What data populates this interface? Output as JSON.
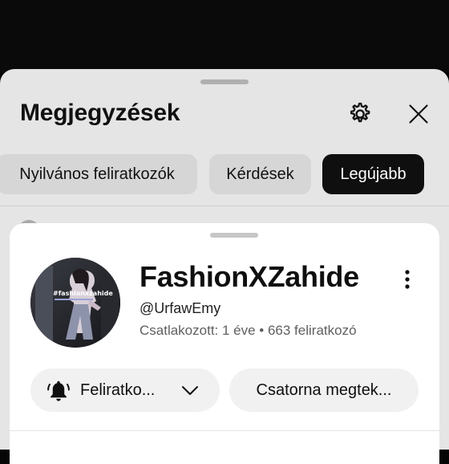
{
  "comments_panel": {
    "title": "Megjegyzések",
    "chips": [
      {
        "label": "Nyilvános feliratkozók",
        "selected": false
      },
      {
        "label": "Kérdések",
        "selected": false
      },
      {
        "label": "Legújabb",
        "selected": true
      }
    ],
    "icons": {
      "settings": "gear-icon",
      "close": "close-icon"
    }
  },
  "channel": {
    "name": "FashionXZahide",
    "handle": "@UrfawEmy",
    "meta": "Csatlakozott: 1 éve • 663 feliratkozó",
    "avatar_text": "#fashionxzahide",
    "subscribe_label": "Feliratko...",
    "channel_button_label": "Csatorna megtek...",
    "icons": {
      "more": "more-vert-icon",
      "bell": "bell-icon",
      "chevron": "chevron-down-icon"
    }
  },
  "colors": {
    "sheet_bg": "#e5e5e5",
    "chip_bg": "#d6d6d6",
    "chip_selected_bg": "#0f0f0f",
    "card_bg": "#ffffff",
    "button_bg": "#f1f1f1",
    "meta_text": "#606060"
  }
}
